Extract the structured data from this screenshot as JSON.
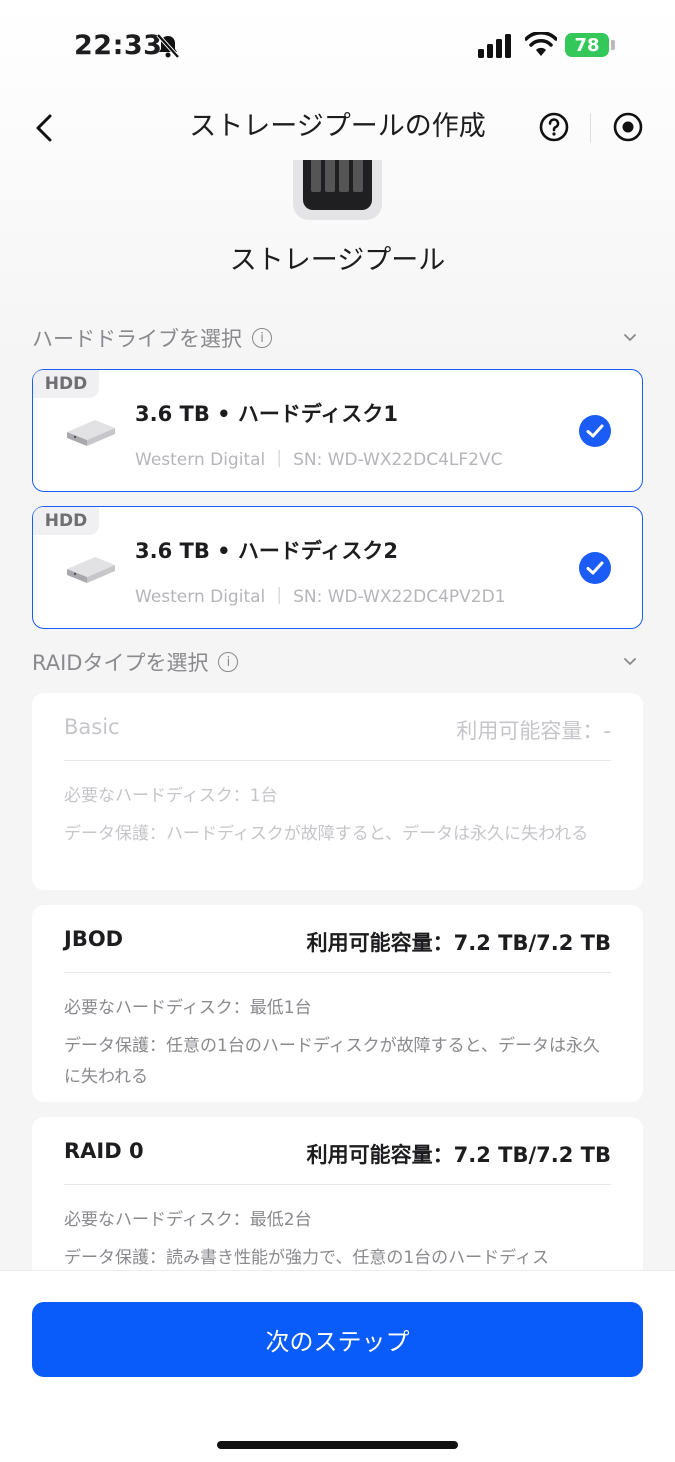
{
  "status_bar": {
    "time": "22:33",
    "battery": "78"
  },
  "nav": {
    "title": "ストレージプールの作成"
  },
  "header": {
    "pool_label": "ストレージプール"
  },
  "drives_section": {
    "title": "ハードドライブを選択",
    "drives": [
      {
        "tag": "HDD",
        "title": "3.6 TB • ハードディスク1",
        "subtitle": "Western Digital ｜ SN: WD-WX22DC4LF2VC",
        "selected": true
      },
      {
        "tag": "HDD",
        "title": "3.6 TB • ハードディスク2",
        "subtitle": "Western Digital ｜ SN: WD-WX22DC4PV2D1",
        "selected": true
      }
    ]
  },
  "raid_section": {
    "title": "RAIDタイプを選択",
    "options": [
      {
        "name": "Basic",
        "capacity": "利用可能容量：-",
        "requirement": "必要なハードディスク：1台",
        "protection": "データ保護：ハードディスクが故障すると、データは永久に失われる",
        "enabled": false
      },
      {
        "name": "JBOD",
        "capacity": "利用可能容量：7.2 TB/7.2 TB",
        "requirement": "必要なハードディスク：最低1台",
        "protection": "データ保護：任意の1台のハードディスクが故障すると、データは永久に失われる",
        "enabled": true
      },
      {
        "name": "RAID 0",
        "capacity": "利用可能容量：7.2 TB/7.2 TB",
        "requirement": "必要なハードディスク：最低2台",
        "protection": "データ保護：読み書き性能が強力で、任意の1台のハードディス",
        "enabled": true
      }
    ]
  },
  "footer": {
    "next_label": "次のステップ"
  },
  "colors": {
    "accent": "#0a5cfa",
    "battery": "#34c759"
  }
}
